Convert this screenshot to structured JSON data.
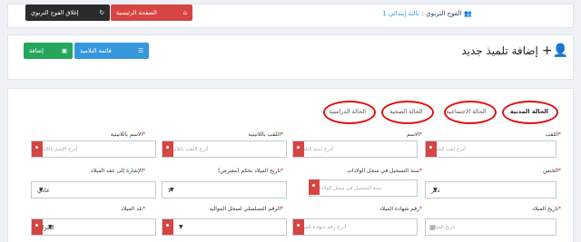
{
  "topbar": {
    "group_label": "الفوج التربوي :",
    "group_value": "ثالثة إبتدائي 1",
    "home_button": "الصفحة الرئيسية",
    "exit_button": "إغلاق الفوج التربوي"
  },
  "header": {
    "title": "إضافة تلميذ جديد",
    "list_button": "قائمة التلاميذ",
    "add_button": "إضافة"
  },
  "tabs": [
    {
      "label": "الحالة المدنية",
      "active": true
    },
    {
      "label": "الحالة الاجتماعية",
      "active": false
    },
    {
      "label": "الحالة الصحية",
      "active": false
    },
    {
      "label": "الحالة الدراسية",
      "active": false
    }
  ],
  "form": {
    "row1": {
      "lastname_label": "اللقب",
      "lastname_placeholder": "أدرج لقب التلميذ",
      "firstname_label": "الاسم",
      "firstname_placeholder": "أدرج إسم التلميذ",
      "lastname_latin_label": "اللقب باللاتينية",
      "lastname_latin_placeholder": "أدرج اللقب باللاتينية",
      "firstname_latin_label": "الاسم باللاتينية",
      "firstname_latin_placeholder": "أدرج الإسم باللاتينية"
    },
    "row2": {
      "gender_label": "الجنس",
      "gender_value": "ذكر",
      "reg_year_label": "سنة التسجيل في سجل الولادات",
      "reg_year_placeholder": "سنة التسجيل في سجل الولادات",
      "presumed_label": "تاريخ الميلاد بحكم (مفترض)",
      "presumed_value": "لا",
      "ref_label": "الإشارة إلى عقد الميلاد",
      "ref_value": "عادي"
    },
    "row3": {
      "birthdate_label": "تاريخ الميلاد",
      "birthdate_placeholder": "تاريخ الميلاد",
      "cert_label": "رقم شهادة الميلاد",
      "cert_placeholder": "أدرج رقم شهادة الميلاد",
      "serial_label": "الرقم التسلسلي لسجل المواليد",
      "serial_value": "0",
      "country_label": "بلد الميلاد",
      "country_value": "الجزائر"
    }
  },
  "colors": {
    "danger": "#d64541",
    "primary": "#3598dc",
    "success": "#26a65b",
    "dark": "#2b2b2b",
    "annotation": "#e01010"
  }
}
